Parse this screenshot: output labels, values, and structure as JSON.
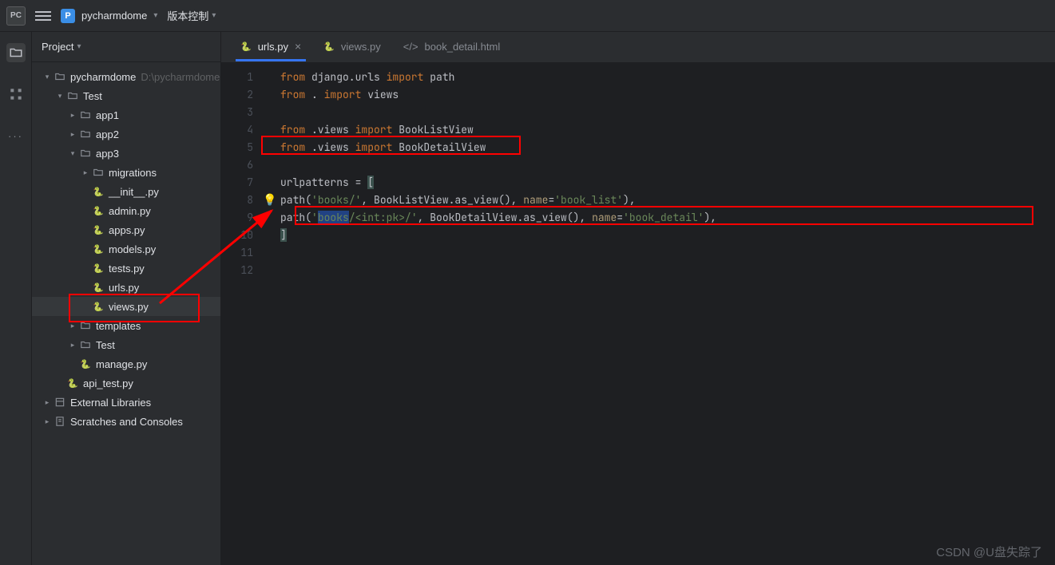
{
  "titlebar": {
    "logo_text": "PC",
    "project_initial": "P",
    "project_name": "pycharmdome",
    "vc_label": "版本控制"
  },
  "sidebar": {
    "title": "Project",
    "tree": [
      {
        "indent": 0,
        "chev": "v",
        "icon": "folder",
        "label": "pycharmdome",
        "hint": "D:\\pycharmdome"
      },
      {
        "indent": 1,
        "chev": "v",
        "icon": "folder",
        "label": "Test"
      },
      {
        "indent": 2,
        "chev": ">",
        "icon": "folder",
        "label": "app1"
      },
      {
        "indent": 2,
        "chev": ">",
        "icon": "folder",
        "label": "app2"
      },
      {
        "indent": 2,
        "chev": "v",
        "icon": "folder",
        "label": "app3"
      },
      {
        "indent": 3,
        "chev": ">",
        "icon": "folder",
        "label": "migrations"
      },
      {
        "indent": 3,
        "chev": "",
        "icon": "py",
        "label": "__init__.py"
      },
      {
        "indent": 3,
        "chev": "",
        "icon": "py",
        "label": "admin.py"
      },
      {
        "indent": 3,
        "chev": "",
        "icon": "py",
        "label": "apps.py"
      },
      {
        "indent": 3,
        "chev": "",
        "icon": "py",
        "label": "models.py"
      },
      {
        "indent": 3,
        "chev": "",
        "icon": "py",
        "label": "tests.py"
      },
      {
        "indent": 3,
        "chev": "",
        "icon": "py",
        "label": "urls.py"
      },
      {
        "indent": 3,
        "chev": "",
        "icon": "py",
        "label": "views.py",
        "selected": true
      },
      {
        "indent": 2,
        "chev": ">",
        "icon": "folder",
        "label": "templates"
      },
      {
        "indent": 2,
        "chev": ">",
        "icon": "folder",
        "label": "Test"
      },
      {
        "indent": 2,
        "chev": "",
        "icon": "py",
        "label": "manage.py"
      },
      {
        "indent": 1,
        "chev": "",
        "icon": "py",
        "label": "api_test.py"
      },
      {
        "indent": 0,
        "chev": ">",
        "icon": "lib",
        "label": "External Libraries"
      },
      {
        "indent": 0,
        "chev": ">",
        "icon": "scratch",
        "label": "Scratches and Consoles"
      }
    ]
  },
  "tabs": [
    {
      "icon": "py",
      "label": "urls.py",
      "active": true,
      "closeable": true
    },
    {
      "icon": "py",
      "label": "views.py",
      "active": false,
      "closeable": false
    },
    {
      "icon": "html",
      "label": "book_detail.html",
      "active": false,
      "closeable": false
    }
  ],
  "code": {
    "lines": [
      {
        "n": 1,
        "html": "<span class='kw'>from</span> django.urls <span class='kw'>import</span> path"
      },
      {
        "n": 2,
        "html": "<span class='kw'>from</span> . <span class='kw'>import</span> views"
      },
      {
        "n": 3,
        "html": ""
      },
      {
        "n": 4,
        "html": "<span class='kw'>from</span> .views <span class='kw'>import</span> BookListView"
      },
      {
        "n": 5,
        "html": "<span class='kw'>from</span> .views <span class='kw'>import</span> BookDetailView"
      },
      {
        "n": 6,
        "html": ""
      },
      {
        "n": 7,
        "html": "urlpatterns = <span class='paren-hl'>[</span>"
      },
      {
        "n": 8,
        "bulb": true,
        "html": "    path(<span class='str'>'books/'</span>, BookListView.as_view(), <span class='param'>name</span>=<span class='str'>'book_list'</span>),"
      },
      {
        "n": 9,
        "html": "    path(<span class='str'>'<span class='sel'>books</span>/&lt;int:pk&gt;/'</span>, BookDetailView.as_view(), <span class='param'>name</span>=<span class='str'>'book_detail'</span>),"
      },
      {
        "n": 10,
        "html": "<span class='paren-hl'>]</span>"
      },
      {
        "n": 11,
        "html": ""
      },
      {
        "n": 12,
        "html": ""
      }
    ]
  },
  "watermark": "CSDN @U盘失踪了"
}
